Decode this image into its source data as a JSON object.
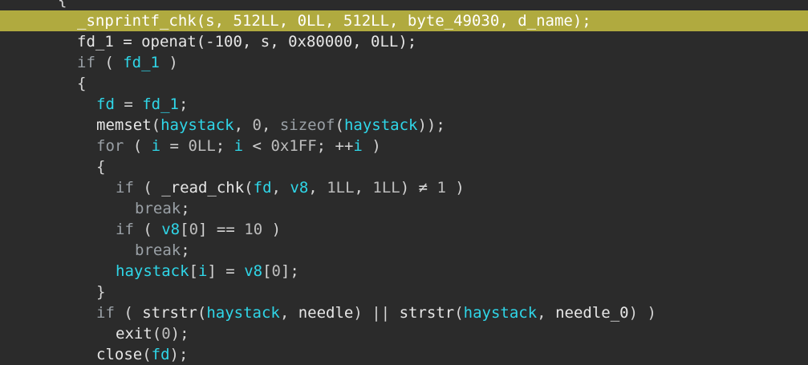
{
  "highlight_line": 1,
  "lines": [
    {
      "indent": 3,
      "tokens": [
        [
          "pun",
          "{"
        ]
      ]
    },
    {
      "indent": 4,
      "tokens": [
        [
          "fn",
          "_snprintf_chk"
        ],
        [
          "pun",
          "("
        ],
        [
          "var",
          "s"
        ],
        [
          "pun",
          ", "
        ],
        [
          "num",
          "512LL"
        ],
        [
          "pun",
          ", "
        ],
        [
          "num",
          "0LL"
        ],
        [
          "pun",
          ", "
        ],
        [
          "num",
          "512LL"
        ],
        [
          "pun",
          ", "
        ],
        [
          "fn",
          "byte_49030"
        ],
        [
          "pun",
          ", "
        ],
        [
          "var",
          "d_name"
        ],
        [
          "pun",
          ");"
        ]
      ]
    },
    {
      "indent": 4,
      "tokens": [
        [
          "fn",
          "fd_1 = openat(-100, s, 0x80000, 0LL);"
        ]
      ]
    },
    {
      "indent": 4,
      "tokens": [
        [
          "kw",
          "if"
        ],
        [
          "pun",
          " ( "
        ],
        [
          "var",
          "fd_1"
        ],
        [
          "pun",
          " )"
        ]
      ]
    },
    {
      "indent": 4,
      "tokens": [
        [
          "pun",
          "{"
        ]
      ]
    },
    {
      "indent": 5,
      "tokens": [
        [
          "var",
          "fd"
        ],
        [
          "pun",
          " = "
        ],
        [
          "var",
          "fd_1"
        ],
        [
          "pun",
          ";"
        ]
      ]
    },
    {
      "indent": 5,
      "tokens": [
        [
          "fn",
          "memset"
        ],
        [
          "pun",
          "("
        ],
        [
          "var",
          "haystack"
        ],
        [
          "pun",
          ", "
        ],
        [
          "num",
          "0"
        ],
        [
          "pun",
          ", "
        ],
        [
          "kw",
          "sizeof"
        ],
        [
          "pun",
          "("
        ],
        [
          "var",
          "haystack"
        ],
        [
          "pun",
          "));"
        ]
      ]
    },
    {
      "indent": 5,
      "tokens": [
        [
          "kw",
          "for"
        ],
        [
          "pun",
          " ( "
        ],
        [
          "var",
          "i"
        ],
        [
          "pun",
          " = "
        ],
        [
          "num",
          "0LL"
        ],
        [
          "pun",
          "; "
        ],
        [
          "var",
          "i"
        ],
        [
          "pun",
          " < "
        ],
        [
          "num",
          "0x1FF"
        ],
        [
          "pun",
          "; "
        ],
        [
          "pun",
          "++"
        ],
        [
          "var",
          "i"
        ],
        [
          "pun",
          " )"
        ]
      ]
    },
    {
      "indent": 5,
      "tokens": [
        [
          "pun",
          "{"
        ]
      ]
    },
    {
      "indent": 6,
      "tokens": [
        [
          "kw",
          "if"
        ],
        [
          "pun",
          " ( "
        ],
        [
          "fn",
          "_read_chk"
        ],
        [
          "pun",
          "("
        ],
        [
          "var",
          "fd"
        ],
        [
          "pun",
          ", "
        ],
        [
          "var",
          "v8"
        ],
        [
          "pun",
          ", "
        ],
        [
          "num",
          "1LL"
        ],
        [
          "pun",
          ", "
        ],
        [
          "num",
          "1LL"
        ],
        [
          "pun",
          ") "
        ],
        [
          "pun",
          "≠"
        ],
        [
          "pun",
          " "
        ],
        [
          "num",
          "1"
        ],
        [
          "pun",
          " )"
        ]
      ]
    },
    {
      "indent": 7,
      "tokens": [
        [
          "kw",
          "break"
        ],
        [
          "pun",
          ";"
        ]
      ]
    },
    {
      "indent": 6,
      "tokens": [
        [
          "kw",
          "if"
        ],
        [
          "pun",
          " ( "
        ],
        [
          "var",
          "v8"
        ],
        [
          "pun",
          "["
        ],
        [
          "num",
          "0"
        ],
        [
          "pun",
          "] "
        ],
        [
          "pun",
          "=="
        ],
        [
          "pun",
          " "
        ],
        [
          "num",
          "10"
        ],
        [
          "pun",
          " )"
        ]
      ]
    },
    {
      "indent": 7,
      "tokens": [
        [
          "kw",
          "break"
        ],
        [
          "pun",
          ";"
        ]
      ]
    },
    {
      "indent": 6,
      "tokens": [
        [
          "var",
          "haystack"
        ],
        [
          "pun",
          "["
        ],
        [
          "var",
          "i"
        ],
        [
          "pun",
          "] = "
        ],
        [
          "var",
          "v8"
        ],
        [
          "pun",
          "["
        ],
        [
          "num",
          "0"
        ],
        [
          "pun",
          "];"
        ]
      ]
    },
    {
      "indent": 5,
      "tokens": [
        [
          "pun",
          "}"
        ]
      ]
    },
    {
      "indent": 5,
      "tokens": [
        [
          "kw",
          "if"
        ],
        [
          "pun",
          " ( "
        ],
        [
          "fn",
          "strstr"
        ],
        [
          "pun",
          "("
        ],
        [
          "var",
          "haystack"
        ],
        [
          "pun",
          ", "
        ],
        [
          "fn",
          "needle"
        ],
        [
          "pun",
          ") || "
        ],
        [
          "fn",
          "strstr"
        ],
        [
          "pun",
          "("
        ],
        [
          "var",
          "haystack"
        ],
        [
          "pun",
          ", "
        ],
        [
          "fn",
          "needle_0"
        ],
        [
          "pun",
          ") )"
        ]
      ]
    },
    {
      "indent": 6,
      "tokens": [
        [
          "fn",
          "exit"
        ],
        [
          "pun",
          "("
        ],
        [
          "num",
          "0"
        ],
        [
          "pun",
          ");"
        ]
      ]
    },
    {
      "indent": 5,
      "tokens": [
        [
          "fn",
          "close"
        ],
        [
          "pun",
          "("
        ],
        [
          "var",
          "fd"
        ],
        [
          "pun",
          ");"
        ]
      ]
    }
  ]
}
